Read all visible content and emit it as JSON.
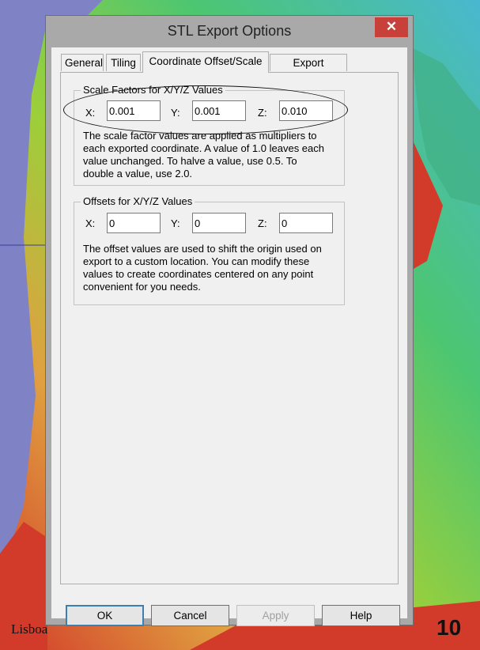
{
  "window": {
    "title": "STL Export Options",
    "close_label": "✕"
  },
  "tabs": [
    {
      "label": "General"
    },
    {
      "label": "Tiling"
    },
    {
      "label": "Coordinate Offset/Scale",
      "active": true
    },
    {
      "label": "Export Bounds"
    }
  ],
  "scale": {
    "title": "Scale Factors for X/Y/Z Values",
    "x_label": "X:",
    "y_label": "Y:",
    "z_label": "Z:",
    "x_value": "0.001",
    "y_value": "0.001",
    "z_value": "0.010",
    "description": [
      "The scale factor values are applied as multipliers to",
      "each exported coordinate. A value of 1.0 leaves each",
      "value unchanged. To halve a value, use 0.5. To",
      "double a value, use 2.0."
    ]
  },
  "offsets": {
    "title": "Offsets for X/Y/Z Values",
    "x_label": "X:",
    "y_label": "Y:",
    "z_label": "Z:",
    "x_value": "0",
    "y_value": "0",
    "z_value": "0",
    "description": [
      "The offset values are used to shift the origin used on",
      "export to a custom location. You can modify these",
      "values to create coordinates centered on any point",
      "convenient for you needs."
    ]
  },
  "buttons": {
    "ok": "OK",
    "cancel": "Cancel",
    "apply": "Apply",
    "help": "Help"
  },
  "background": {
    "map_label": "Lisboa",
    "page_number": "10",
    "sea_color": "#7f82c4"
  }
}
